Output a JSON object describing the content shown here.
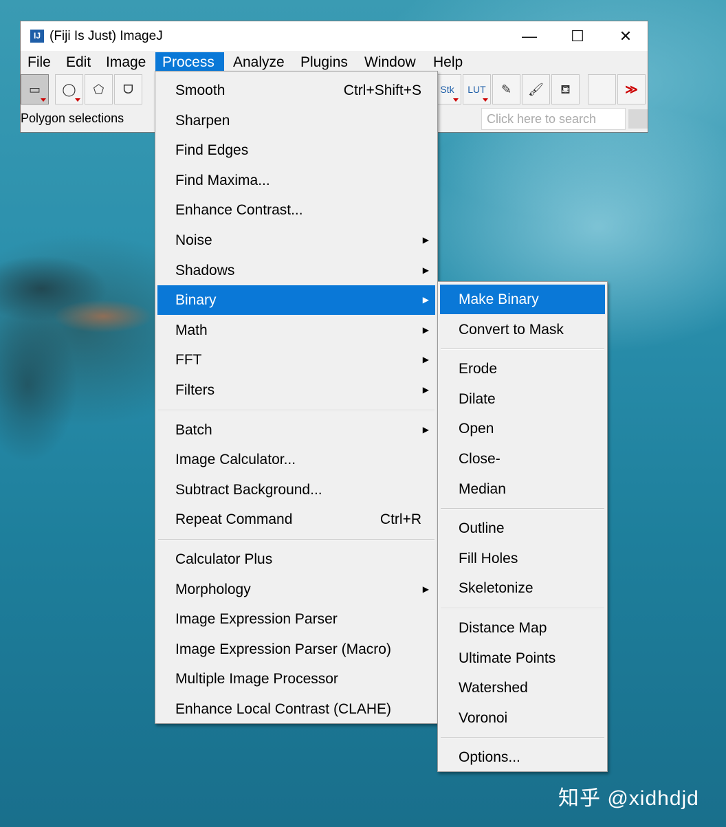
{
  "window": {
    "icon_label": "IJ",
    "title": "(Fiji Is Just) ImageJ",
    "minimize": "—",
    "maximize": "☐",
    "close": "✕"
  },
  "menubar": [
    "File",
    "Edit",
    "Image",
    "Process",
    "Analyze",
    "Plugins",
    "Window",
    "Help"
  ],
  "active_menu": "Process",
  "toolbar": {
    "tools": [
      {
        "icon": "rectangle-tool-icon",
        "glyph": "▭"
      },
      {
        "icon": "oval-tool-icon",
        "glyph": "◯"
      },
      {
        "icon": "polygon-tool-icon",
        "glyph": "⬠"
      },
      {
        "icon": "freehand-tool-icon",
        "glyph": "ᗜ"
      },
      {
        "icon": "stk-tool-icon",
        "glyph": "Stk"
      },
      {
        "icon": "lut-tool-icon",
        "glyph": "LUT"
      },
      {
        "icon": "pencil-tool-icon",
        "glyph": "✎"
      },
      {
        "icon": "brush-tool-icon",
        "glyph": "🖌"
      },
      {
        "icon": "flood-fill-tool-icon",
        "glyph": "⛾"
      },
      {
        "icon": "empty-tool-slot",
        "glyph": ""
      },
      {
        "icon": "more-tools-icon",
        "glyph": "≫"
      }
    ]
  },
  "status_text": "Polygon selections",
  "search": {
    "placeholder": "Click here to search"
  },
  "process_menu": {
    "items": [
      {
        "label": "Smooth",
        "shortcut": "Ctrl+Shift+S",
        "submenu": false
      },
      {
        "label": "Sharpen",
        "shortcut": "",
        "submenu": false
      },
      {
        "label": "Find Edges",
        "shortcut": "",
        "submenu": false
      },
      {
        "label": "Find Maxima...",
        "shortcut": "",
        "submenu": false
      },
      {
        "label": "Enhance Contrast...",
        "shortcut": "",
        "submenu": false
      },
      {
        "label": "Noise",
        "shortcut": "",
        "submenu": true
      },
      {
        "label": "Shadows",
        "shortcut": "",
        "submenu": true
      },
      {
        "label": "Binary",
        "shortcut": "",
        "submenu": true,
        "highlight": true
      },
      {
        "label": "Math",
        "shortcut": "",
        "submenu": true
      },
      {
        "label": "FFT",
        "shortcut": "",
        "submenu": true
      },
      {
        "label": "Filters",
        "shortcut": "",
        "submenu": true
      },
      {
        "separator": true
      },
      {
        "label": "Batch",
        "shortcut": "",
        "submenu": true
      },
      {
        "label": "Image Calculator...",
        "shortcut": "",
        "submenu": false
      },
      {
        "label": "Subtract Background...",
        "shortcut": "",
        "submenu": false
      },
      {
        "label": "Repeat Command",
        "shortcut": "Ctrl+R",
        "submenu": false
      },
      {
        "separator": true
      },
      {
        "label": "Calculator Plus",
        "shortcut": "",
        "submenu": false
      },
      {
        "label": "Morphology",
        "shortcut": "",
        "submenu": true
      },
      {
        "label": "Image Expression Parser",
        "shortcut": "",
        "submenu": false
      },
      {
        "label": "Image Expression Parser (Macro)",
        "shortcut": "",
        "submenu": false
      },
      {
        "label": "Multiple Image Processor",
        "shortcut": "",
        "submenu": false
      },
      {
        "label": "Enhance Local Contrast (CLAHE)",
        "shortcut": "",
        "submenu": false
      }
    ]
  },
  "binary_menu": {
    "items": [
      {
        "label": "Make Binary",
        "highlight": true
      },
      {
        "label": "Convert to Mask"
      },
      {
        "separator": true
      },
      {
        "label": "Erode"
      },
      {
        "label": "Dilate"
      },
      {
        "label": "Open"
      },
      {
        "label": "Close-"
      },
      {
        "label": "Median"
      },
      {
        "separator": true
      },
      {
        "label": "Outline"
      },
      {
        "label": "Fill Holes"
      },
      {
        "label": "Skeletonize"
      },
      {
        "separator": true
      },
      {
        "label": "Distance Map"
      },
      {
        "label": "Ultimate Points"
      },
      {
        "label": "Watershed"
      },
      {
        "label": "Voronoi"
      },
      {
        "separator": true
      },
      {
        "label": "Options..."
      }
    ]
  },
  "watermark": "知乎 @xidhdjd",
  "colors": {
    "highlight": "#0a78d7",
    "menu_bg": "#f0f0f0",
    "more_tools": "#cc0000"
  }
}
